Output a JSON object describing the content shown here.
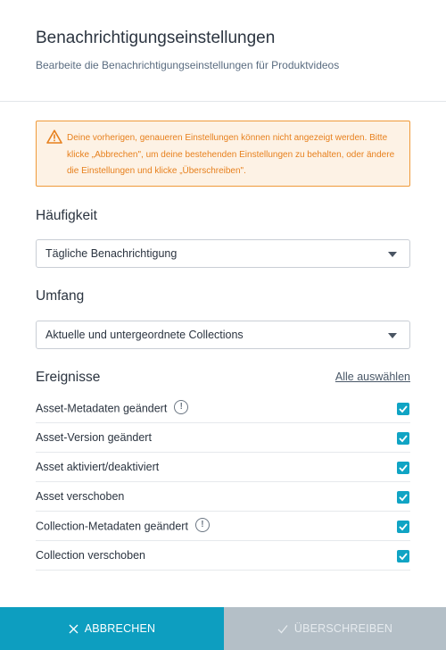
{
  "header": {
    "title": "Benachrichtigungseinstellungen",
    "subtitle": "Bearbeite die Benachrichtigungseinstellungen für Produktvideos"
  },
  "warning": {
    "icon": "warning-icon",
    "text": "Deine vorherigen, genaueren Einstellungen können nicht angezeigt werden. Bitte klicke „Abbrechen\", um deine bestehenden Einstellungen zu behalten, oder ändere die Einstellungen und klicke „Überschreiben\"."
  },
  "frequency": {
    "label": "Häufigkeit",
    "selected": "Tägliche Benachrichtigung"
  },
  "scope": {
    "label": "Umfang",
    "selected": "Aktuelle und untergeordnete Collections"
  },
  "events": {
    "label": "Ereignisse",
    "select_all": "Alle auswählen",
    "items": [
      {
        "label": "Asset-Metadaten geändert",
        "info": true,
        "checked": true
      },
      {
        "label": "Asset-Version geändert",
        "info": false,
        "checked": true
      },
      {
        "label": "Asset aktiviert/deaktiviert",
        "info": false,
        "checked": true
      },
      {
        "label": "Asset verschoben",
        "info": false,
        "checked": true
      },
      {
        "label": "Collection-Metadaten geändert",
        "info": true,
        "checked": true
      },
      {
        "label": "Collection verschoben",
        "info": false,
        "checked": true
      }
    ]
  },
  "footer": {
    "cancel_label": "ABBRECHEN",
    "overwrite_label": "ÜBERSCHREIBEN"
  },
  "colors": {
    "accent": "#0d9ec0",
    "checkbox": "#10a4c4",
    "warning": "#e7801d",
    "disabled_button": "#b4bfc7"
  }
}
